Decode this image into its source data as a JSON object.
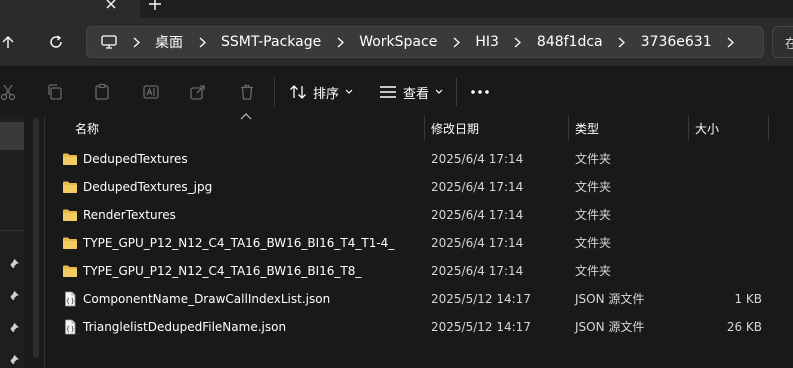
{
  "breadcrumb": [
    "桌面",
    "SSMT-Package",
    "WorkSpace",
    "HI3",
    "848f1dca",
    "3736e631"
  ],
  "search": {
    "text": "在"
  },
  "toolbar": {
    "sort_label": "排序",
    "view_label": "查看"
  },
  "columns": {
    "name": "名称",
    "modified": "修改日期",
    "type": "类型",
    "size": "大小"
  },
  "files": [
    {
      "icon": "folder-icon",
      "name": "DedupedTextures",
      "modified": "2025/6/4 17:14",
      "type": "文件夹",
      "size": ""
    },
    {
      "icon": "folder-icon",
      "name": "DedupedTextures_jpg",
      "modified": "2025/6/4 17:14",
      "type": "文件夹",
      "size": ""
    },
    {
      "icon": "folder-icon",
      "name": "RenderTextures",
      "modified": "2025/6/4 17:14",
      "type": "文件夹",
      "size": ""
    },
    {
      "icon": "folder-icon",
      "name": "TYPE_GPU_P12_N12_C4_TA16_BW16_BI16_T4_T1-4_",
      "modified": "2025/6/4 17:14",
      "type": "文件夹",
      "size": ""
    },
    {
      "icon": "folder-icon",
      "name": "TYPE_GPU_P12_N12_C4_TA16_BW16_BI16_T8_",
      "modified": "2025/6/4 17:14",
      "type": "文件夹",
      "size": ""
    },
    {
      "icon": "json-file-icon",
      "name": "ComponentName_DrawCallIndexList.json",
      "modified": "2025/5/12 14:17",
      "type": "JSON 源文件",
      "size": "1 KB"
    },
    {
      "icon": "json-file-icon",
      "name": "TrianglelistDedupedFileName.json",
      "modified": "2025/5/12 14:17",
      "type": "JSON 源文件",
      "size": "26 KB"
    }
  ],
  "colors": {
    "background": "#191919",
    "folder": "#e8b84a",
    "text": "#ffffff",
    "secondary_text": "#d6d6d6"
  }
}
